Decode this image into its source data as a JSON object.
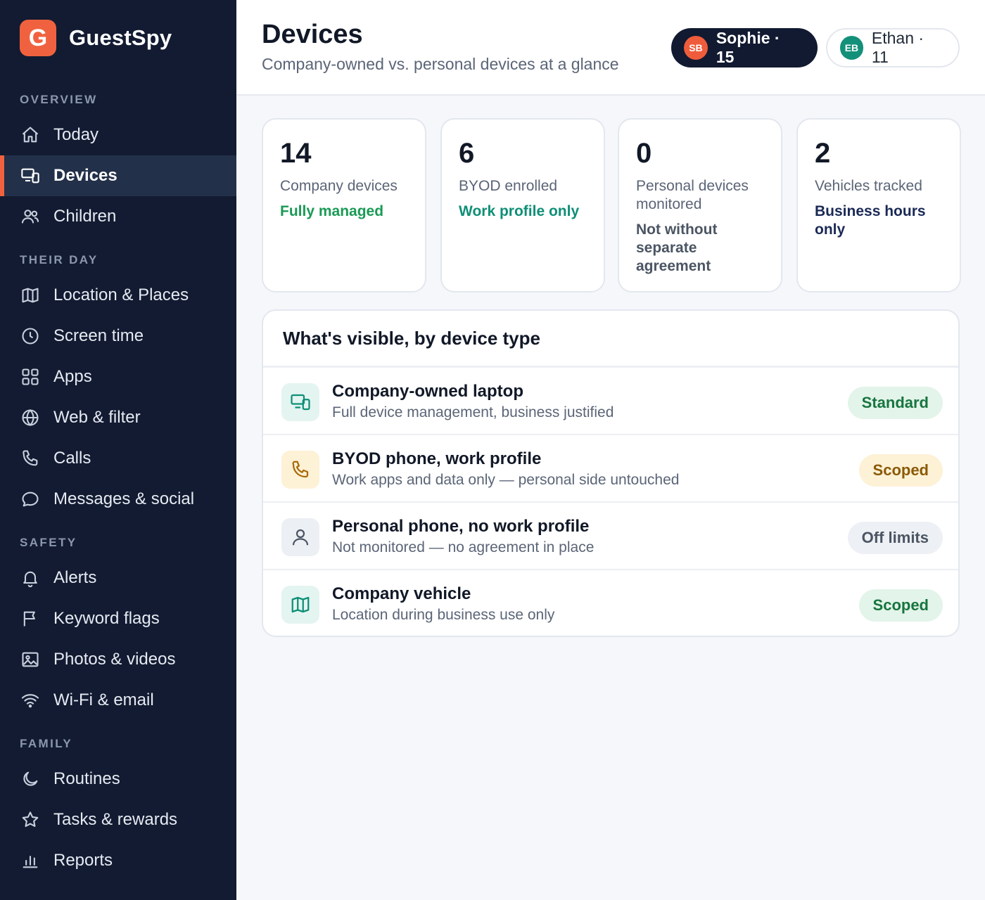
{
  "app": {
    "name": "GuestSpy",
    "logo_letter": "G",
    "brand_color": "#f0623f"
  },
  "sidebar": {
    "sections": {
      "overview": "OVERVIEW",
      "their_day": "THEIR DAY",
      "safety": "SAFETY",
      "family": "FAMILY"
    },
    "items": {
      "today": "Today",
      "devices": "Devices",
      "children": "Children",
      "location": "Location & Places",
      "screen_time": "Screen time",
      "apps": "Apps",
      "web_filter": "Web & filter",
      "calls": "Calls",
      "messages": "Messages & social",
      "alerts": "Alerts",
      "keyword_flags": "Keyword flags",
      "photos": "Photos & videos",
      "wifi": "Wi-Fi & email",
      "routines": "Routines",
      "tasks": "Tasks & rewards",
      "reports": "Reports"
    },
    "active_item": "Devices"
  },
  "header": {
    "title": "Devices",
    "subtitle": "Company-owned vs. personal devices at a glance",
    "profiles": [
      {
        "initials": "SB",
        "label": "Sophie · 15",
        "selected": true
      },
      {
        "initials": "EB",
        "label": "Ethan · 11",
        "selected": false
      }
    ]
  },
  "stats": [
    {
      "value": "14",
      "label": "Company devices",
      "note": "Fully managed"
    },
    {
      "value": "6",
      "label": "BYOD enrolled",
      "note": "Work profile only"
    },
    {
      "value": "0",
      "label": "Personal devices monitored",
      "note": "Not without separate agreement"
    },
    {
      "value": "2",
      "label": "Vehicles tracked",
      "note": "Business hours only"
    }
  ],
  "visibility": {
    "title": "What's visible, by device type",
    "rows": [
      {
        "icon": "devices-icon",
        "title": "Company-owned laptop",
        "desc": "Full device management, business justified",
        "badge": "Standard"
      },
      {
        "icon": "phone-icon",
        "title": "BYOD phone, work profile",
        "desc": "Work apps and data only — personal side untouched",
        "badge": "Scoped"
      },
      {
        "icon": "person-icon",
        "title": "Personal phone, no work profile",
        "desc": "Not monitored — no agreement in place",
        "badge": "Off limits"
      },
      {
        "icon": "map-icon",
        "title": "Company vehicle",
        "desc": "Location during business use only",
        "badge": "Scoped"
      }
    ]
  },
  "colors": {
    "sidebar_bg": "#121b31",
    "accent": "#f0623f",
    "green": "#1a9a55",
    "teal": "#0e8f76",
    "amber": "#8a5a06"
  }
}
